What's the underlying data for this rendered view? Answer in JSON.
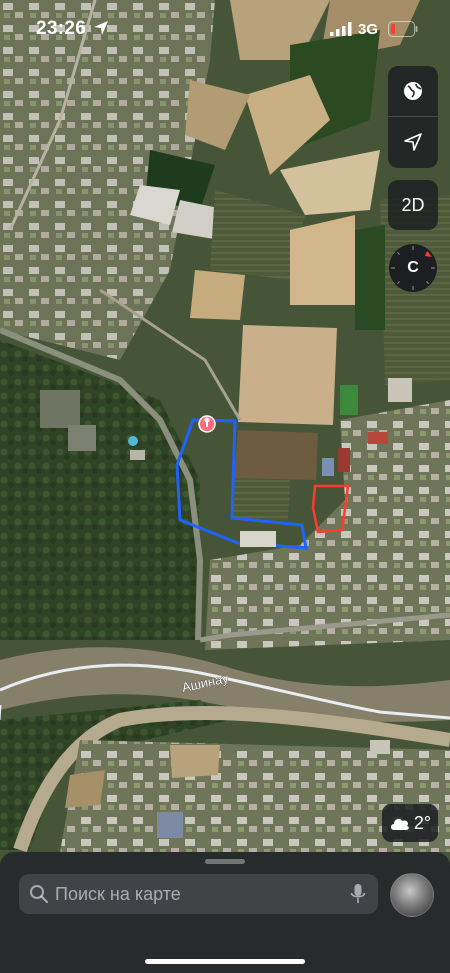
{
  "status_bar": {
    "time": "23:26",
    "network": "3G"
  },
  "map": {
    "road_label": "Ашинау",
    "pin_icon": "tree-pin-icon",
    "colors": {
      "blue_boundary": "#1f63ff",
      "red_boundary": "#ff3b30",
      "river": "#e9eef4"
    }
  },
  "controls": {
    "globe_icon": "globe-icon",
    "location_icon": "location-arrow-icon",
    "view_mode_label": "2D",
    "compass_label": "C"
  },
  "weather": {
    "icon": "cloud-icon",
    "temperature": "2°"
  },
  "search": {
    "placeholder": "Поиск на карте",
    "icon": "search-icon",
    "mic_icon": "microphone-icon"
  },
  "profile": {
    "icon": "avatar"
  }
}
